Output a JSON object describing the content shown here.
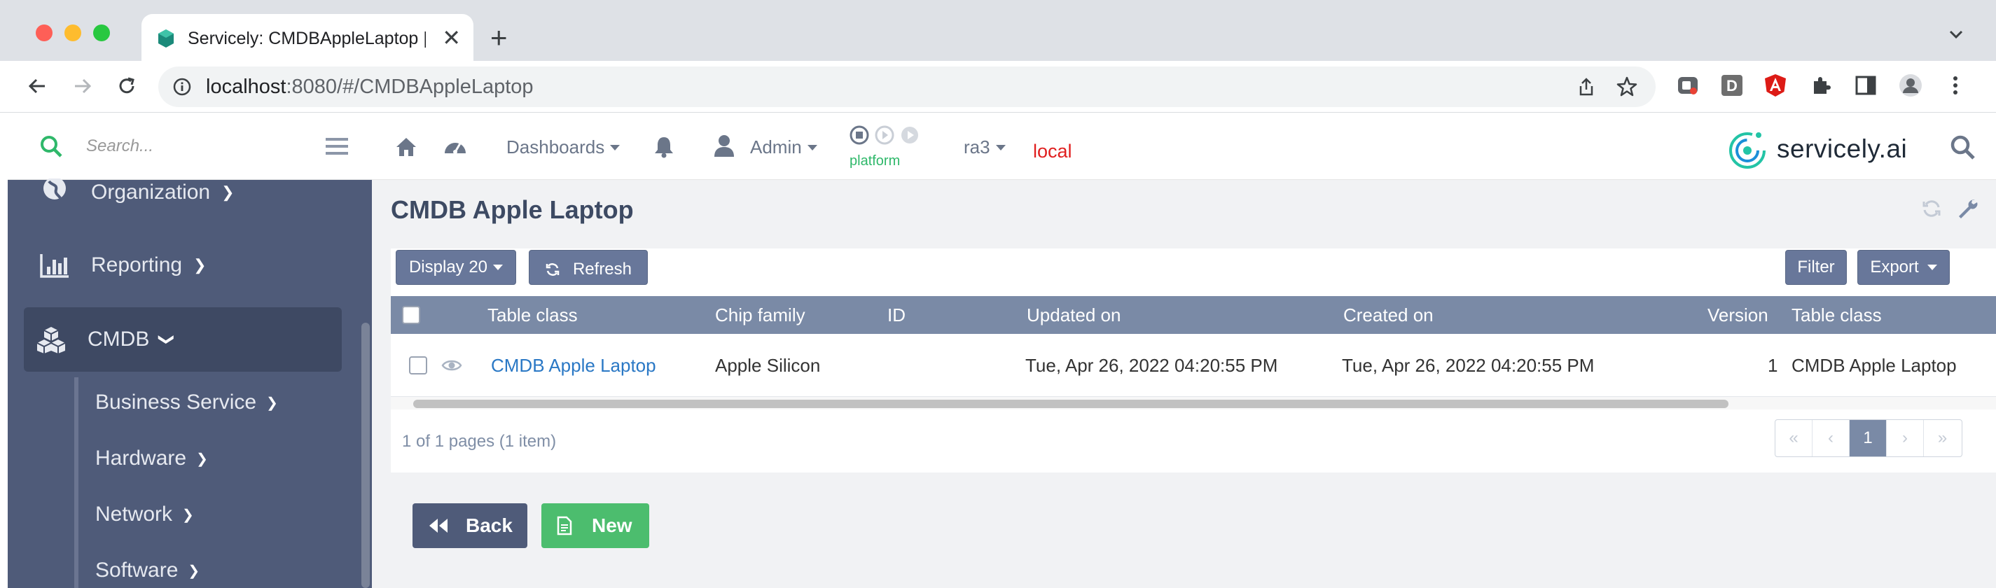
{
  "browser": {
    "tab_title": "Servicely: CMDBAppleLaptop | ",
    "url_host": "localhost",
    "url_path": ":8080/#/CMDBAppleLaptop"
  },
  "sidebar": {
    "search_placeholder": "Search...",
    "items": [
      {
        "label": "Organization",
        "icon": "globe-icon"
      },
      {
        "label": "Reporting",
        "icon": "bar-chart-icon"
      },
      {
        "label": "CMDB",
        "icon": "cubes-icon"
      }
    ],
    "subitems": [
      {
        "label": "Business Service"
      },
      {
        "label": "Hardware"
      },
      {
        "label": "Network"
      },
      {
        "label": "Software"
      }
    ]
  },
  "topnav": {
    "dashboards": "Dashboards",
    "user": "Admin",
    "platform": "platform",
    "instance": "ra3",
    "env": "local",
    "brand": "servicely.ai"
  },
  "page": {
    "title": "CMDB Apple Laptop",
    "display_label": "Display 20",
    "refresh_label": "Refresh",
    "filter_label": "Filter",
    "export_label": "Export"
  },
  "table": {
    "columns": [
      "Table class",
      "Chip family",
      "ID",
      "Updated on",
      "Created on",
      "Version",
      "Table class"
    ],
    "rows": [
      {
        "table_class": "CMDB Apple Laptop",
        "chip_family": "Apple Silicon",
        "id": "",
        "updated_on": "Tue, Apr 26, 2022 04:20:55 PM",
        "created_on": "Tue, Apr 26, 2022 04:20:55 PM",
        "version": "1",
        "table_class_2": "CMDB Apple Laptop"
      }
    ],
    "pager_info": "1 of 1 pages (1 item)",
    "current_page": "1"
  },
  "actions": {
    "back": "Back",
    "new": "New"
  },
  "colors": {
    "sidebar_bg": "#4f5b79",
    "header_bg": "#7a8aa6",
    "back_btn": "#4f5b79",
    "new_btn": "#4cbd6e",
    "link": "#2a78c5"
  }
}
